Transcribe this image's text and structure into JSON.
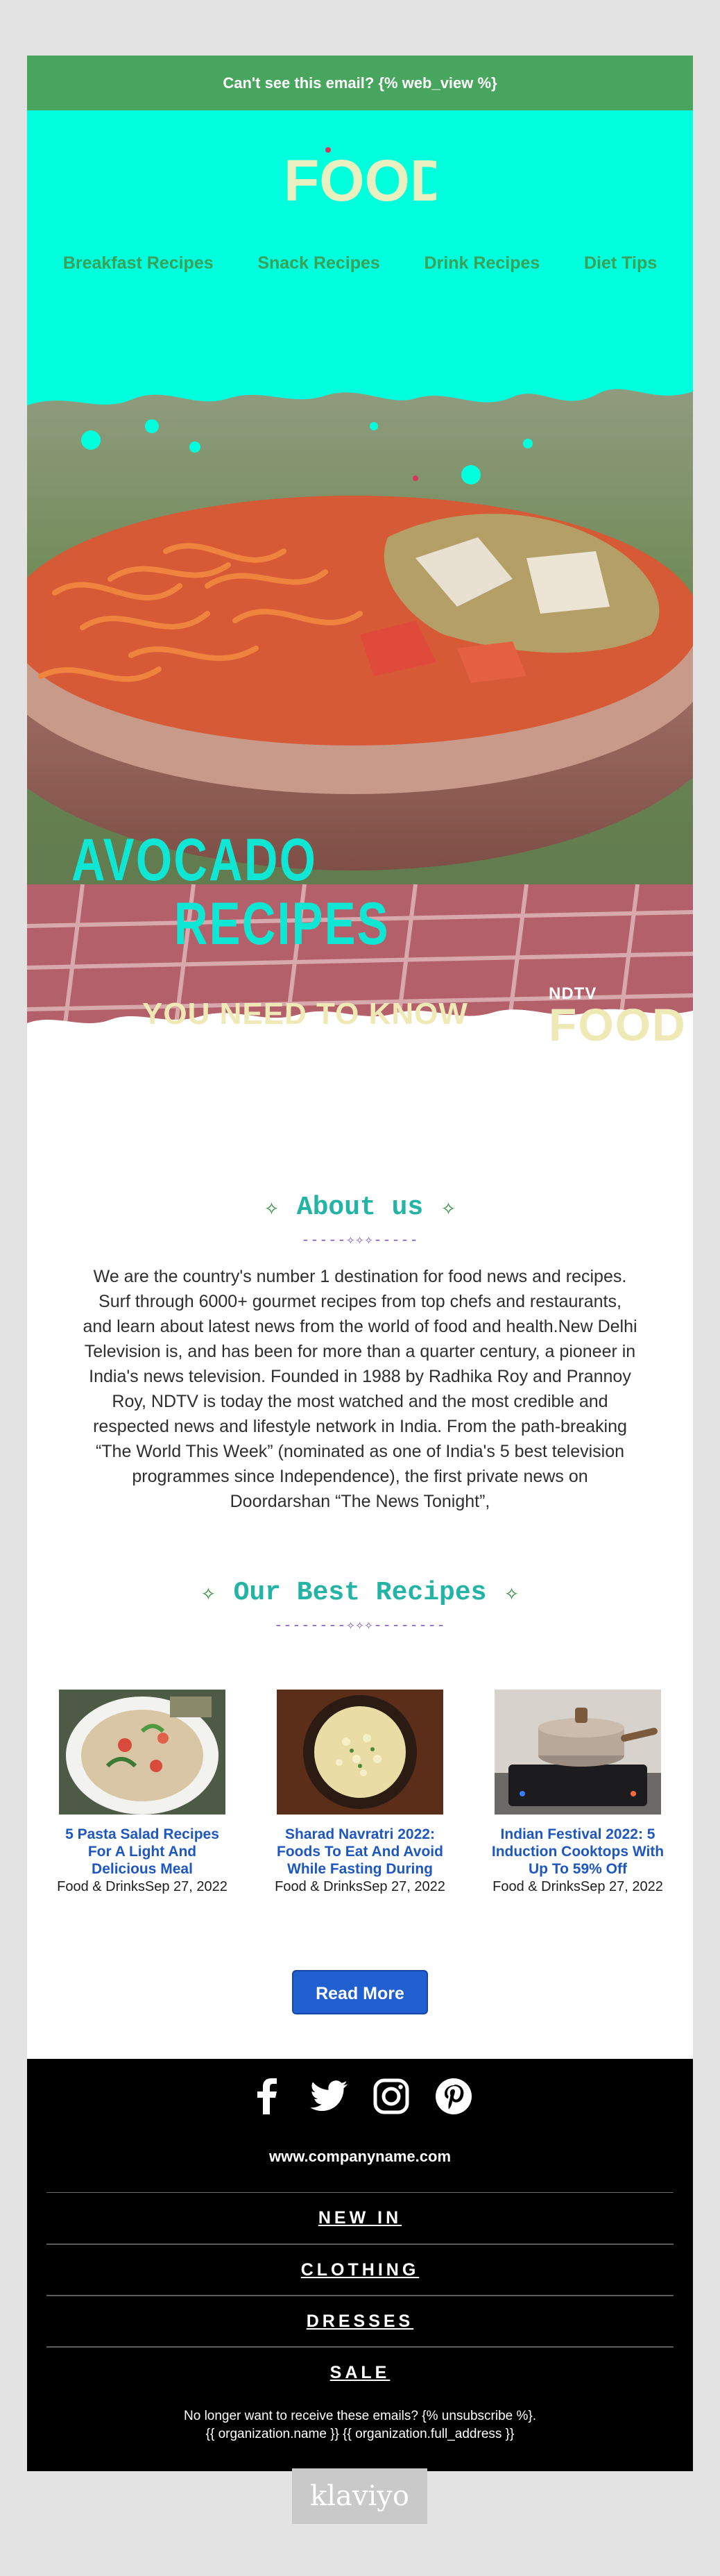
{
  "topbar": {
    "text": "Can't see this email? {% web_view %}"
  },
  "header": {
    "logo_text": "FOOD",
    "nav": [
      {
        "label": "Breakfast Recipes"
      },
      {
        "label": "Snack Recipes"
      },
      {
        "label": "Drink Recipes"
      },
      {
        "label": "Diet Tips"
      }
    ]
  },
  "hero": {
    "line1": "AVOCADO",
    "line2": "RECIPES",
    "subtitle": "YOU NEED TO KNOW",
    "brand_small": "NDTV",
    "brand_large": "FOOD"
  },
  "about": {
    "title": "About us",
    "divider": "-----✧✧✧-----",
    "text": "We are the country's number 1 destination for food news and recipes. Surf through 6000+ gourmet recipes from top chefs and restaurants, and learn about latest news from the world of food and health.New Delhi Television is, and has been for more than a quarter century, a pioneer in India's news television. Founded in 1988 by Radhika Roy and Prannoy Roy, NDTV is today the most watched and the most credible and respected news and lifestyle network in India. From the path-breaking “The World This Week” (nominated as one of India's 5 best television programmes since Independence), the first private news on Doordarshan “The News Tonight”,"
  },
  "recipes": {
    "title": "Our Best Recipes",
    "divider": "--------✧✧✧--------",
    "cards": [
      {
        "title": "5 Pasta Salad Recipes For A Light And Delicious Meal",
        "meta": "Food & DrinksSep 27, 2022"
      },
      {
        "title": "Sharad Navratri 2022: Foods To Eat And Avoid While Fasting During",
        "meta": "Food & DrinksSep 27, 2022"
      },
      {
        "title": "Indian Festival 2022: 5 Induction Cooktops With Up To 59% Off",
        "meta": "Food & DrinksSep 27, 2022"
      }
    ]
  },
  "cta": {
    "label": "Read More"
  },
  "footer": {
    "social": [
      "facebook-icon",
      "twitter-icon",
      "instagram-icon",
      "pinterest-icon"
    ],
    "website": "www.companyname.com",
    "menu": [
      {
        "label": "NEW IN"
      },
      {
        "label": "CLOTHING"
      },
      {
        "label": "DRESSES"
      },
      {
        "label": "SALE"
      }
    ],
    "unsubscribe": "No longer want to receive these emails? {% unsubscribe %}.",
    "address": "{{ organization.name }} {{ organization.full_address }}"
  },
  "badge": {
    "text": "klaviyo"
  },
  "colors": {
    "topbar": "#47a55e",
    "header_bg": "#00ffdc",
    "nav_text": "#3aa05a",
    "section_title": "#23b4a6",
    "link": "#1e57bf",
    "button": "#1f5fd0",
    "footer_bg": "#000000"
  }
}
